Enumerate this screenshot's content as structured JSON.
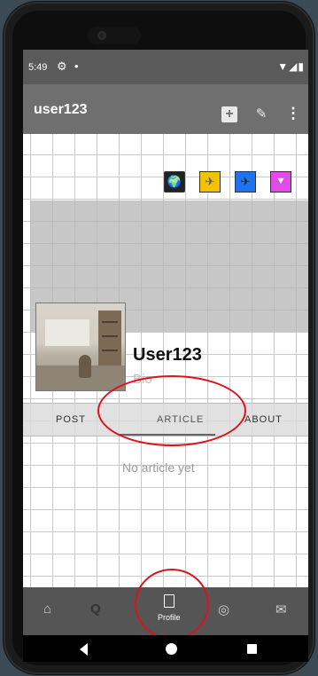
{
  "status_bar": {
    "time": "5:49",
    "settings_glyph": "⚙",
    "dot": "•",
    "system_icons": "▼◢▮"
  },
  "app_bar": {
    "title": "user123",
    "add_glyph": "+",
    "edit_glyph": "✎",
    "more_glyph": "⋮"
  },
  "social_links": [
    {
      "icon": "globe-icon",
      "glyph": "🌍",
      "color": "#222222"
    },
    {
      "icon": "plane-icon",
      "glyph": "✈",
      "color": "#f3c200"
    },
    {
      "icon": "plane-icon",
      "glyph": "✈",
      "color": "#1e74f0"
    },
    {
      "icon": "bookmark-icon",
      "glyph": "⯆",
      "color": "#e04ce6"
    }
  ],
  "profile": {
    "username": "User123",
    "bio": "Bio"
  },
  "tabs": {
    "post": "POST",
    "article": "ARTICLE",
    "about": "ABOUT",
    "selected": "ARTICLE"
  },
  "article_empty_text": "No article yet",
  "bottom_nav": {
    "home_glyph": "⌂",
    "search_glyph": "Q",
    "profile_label": "Profile",
    "camera_glyph": "◎",
    "mail_glyph": "✉"
  },
  "annotation_color": "#e0101a"
}
